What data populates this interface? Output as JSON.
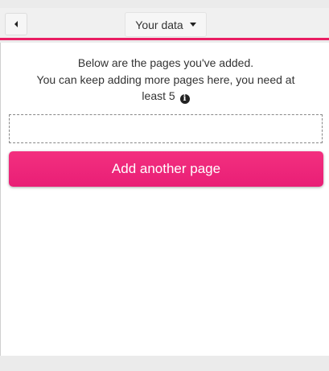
{
  "header": {
    "menu_label": "Your data",
    "back_icon": "caret-left-icon",
    "dropdown_icon": "caret-down-icon",
    "accent_color": "#e91e63"
  },
  "main": {
    "intro_line_1": "Below are the pages you've added.",
    "intro_line_2": "You can keep adding more pages here, you need at least 5",
    "info_icon": "info-circle-icon",
    "add_button_label": "Add another page",
    "button_color": "#ec1f77"
  }
}
